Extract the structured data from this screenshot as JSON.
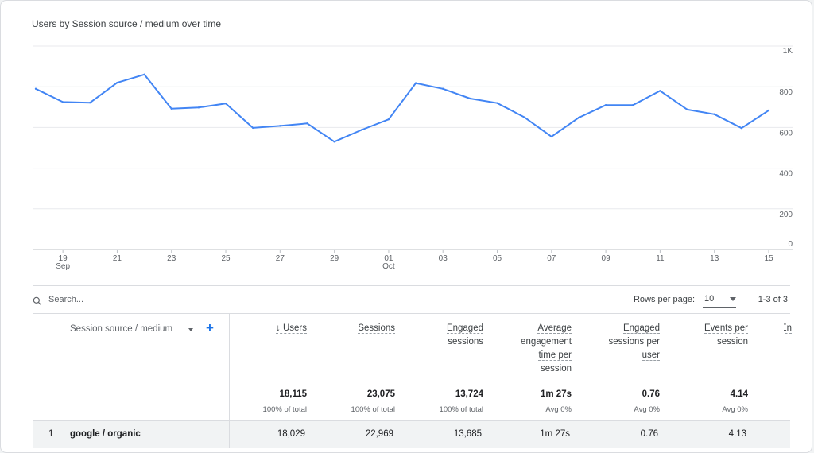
{
  "chart_title": "Users by Session source / medium over time",
  "chart_data": {
    "type": "line",
    "title": "Users by Session source / medium over time",
    "x": [
      "Sep 18",
      "Sep 19",
      "Sep 20",
      "Sep 21",
      "Sep 22",
      "Sep 23",
      "Sep 24",
      "Sep 25",
      "Sep 26",
      "Sep 27",
      "Sep 28",
      "Sep 29",
      "Sep 30",
      "Oct 01",
      "Oct 02",
      "Oct 03",
      "Oct 04",
      "Oct 05",
      "Oct 06",
      "Oct 07",
      "Oct 08",
      "Oct 09",
      "Oct 10",
      "Oct 11",
      "Oct 12",
      "Oct 13",
      "Oct 14",
      "Oct 15"
    ],
    "series": [
      {
        "values": [
          790,
          725,
          722,
          820,
          860,
          692,
          698,
          718,
          598,
          608,
          620,
          530,
          588,
          640,
          818,
          790,
          742,
          720,
          650,
          555,
          648,
          710,
          710,
          780,
          688,
          665,
          597,
          684
        ]
      }
    ],
    "ylim": [
      0,
      1000
    ],
    "y_ticks": [
      "0",
      "200",
      "400",
      "600",
      "800",
      "1K"
    ],
    "x_ticks": [
      {
        "label": "19",
        "sub": "Sep"
      },
      {
        "label": "21",
        "sub": ""
      },
      {
        "label": "23",
        "sub": ""
      },
      {
        "label": "25",
        "sub": ""
      },
      {
        "label": "27",
        "sub": ""
      },
      {
        "label": "29",
        "sub": ""
      },
      {
        "label": "01",
        "sub": "Oct"
      },
      {
        "label": "03",
        "sub": ""
      },
      {
        "label": "05",
        "sub": ""
      },
      {
        "label": "07",
        "sub": ""
      },
      {
        "label": "09",
        "sub": ""
      },
      {
        "label": "11",
        "sub": ""
      },
      {
        "label": "13",
        "sub": ""
      },
      {
        "label": "15",
        "sub": ""
      }
    ],
    "grid": true,
    "line_color": "#4285f4"
  },
  "toolbar": {
    "search_placeholder": "Search...",
    "rows_per_page_label": "Rows per page:",
    "rows_per_page_value": "10",
    "range_text": "1-3 of 3"
  },
  "table": {
    "dimension_header": "Session source / medium",
    "columns": [
      {
        "header": "↓ Users",
        "total": "18,115",
        "sub": "100% of total"
      },
      {
        "header": "Sessions",
        "total": "23,075",
        "sub": "100% of total"
      },
      {
        "header": "Engaged sessions",
        "total": "13,724",
        "sub": "100% of total"
      },
      {
        "header": "Average engagement time per session",
        "total": "1m 27s",
        "sub": "Avg 0%"
      },
      {
        "header": "Engaged sessions per user",
        "total": "0.76",
        "sub": "Avg 0%"
      },
      {
        "header": "Events per session",
        "total": "4.14",
        "sub": "Avg 0%"
      },
      {
        "header": "En",
        "total": "",
        "sub": ""
      }
    ],
    "rows": [
      {
        "index": "1",
        "dimension": "google / organic",
        "values": [
          "18,029",
          "22,969",
          "13,685",
          "1m 27s",
          "0.76",
          "4.13",
          ""
        ]
      }
    ]
  }
}
